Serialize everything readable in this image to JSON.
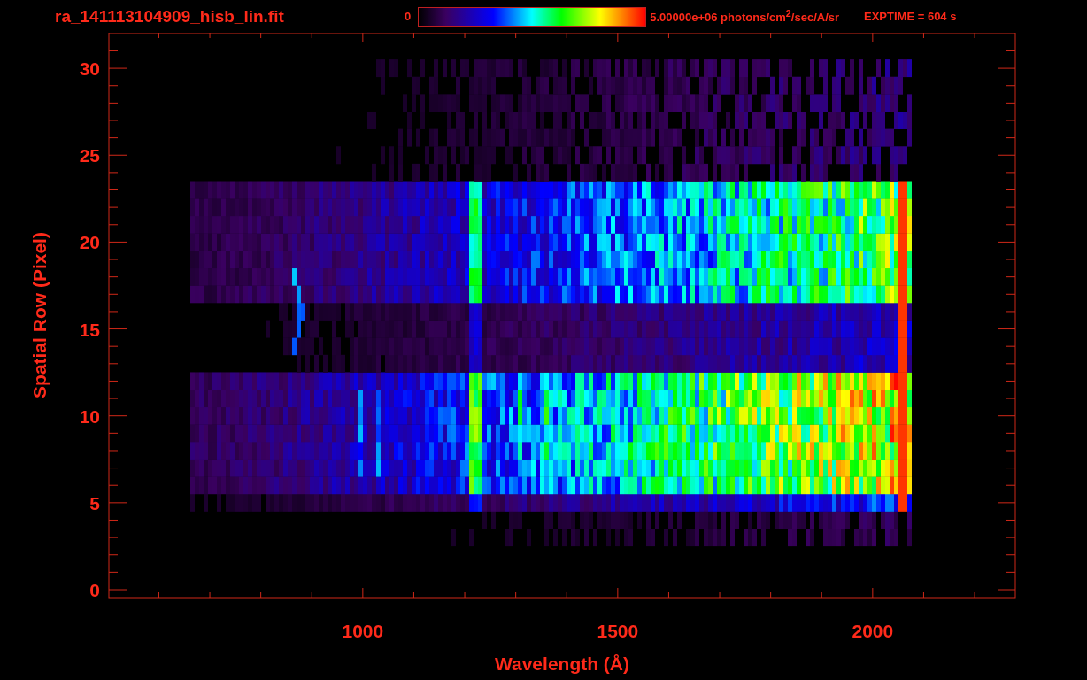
{
  "title": "ra_141113104909_hisb_lin.fit",
  "colorbar": {
    "min_label": "0",
    "max_label": "5.00000e+06 photons/cm$^{2}$/sec/A/sr"
  },
  "exposure": "EXPTIME = 604 s",
  "plot": {
    "xlabel": "Wavelength (Å)",
    "ylabel": "Spatial Row (Pixel)",
    "x_tick_labels": [
      "1000",
      "1500",
      "2000"
    ],
    "y_tick_labels": [
      "30",
      "25",
      "20",
      "15",
      "10",
      "5",
      "0"
    ]
  }
}
